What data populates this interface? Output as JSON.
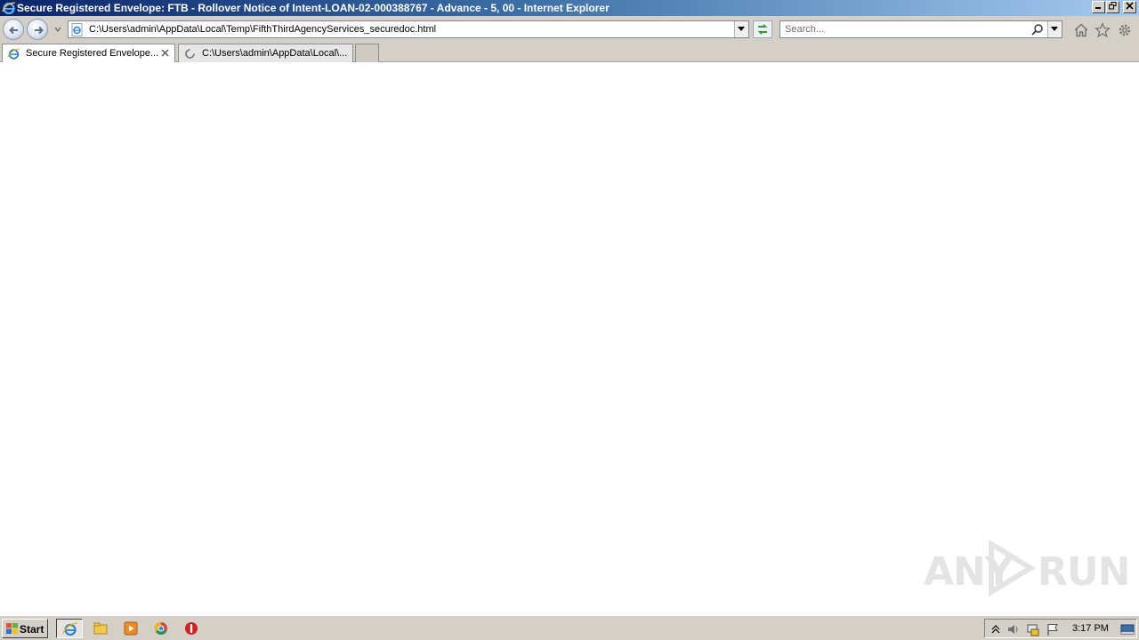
{
  "window": {
    "title": "Secure Registered Envelope: FTB - Rollover Notice of Intent-LOAN-02-000388767 - Advance - 5, 00 - Internet Explorer",
    "buttons": [
      "minimize",
      "restore",
      "close"
    ]
  },
  "navbar": {
    "address_url": "C:\\Users\\admin\\AppData\\Local\\Temp\\FifthThirdAgencyServices_securedoc.html",
    "search_placeholder": "Search...",
    "icons": [
      "back-icon",
      "forward-icon",
      "home-icon",
      "favorites-star-icon",
      "settings-gear-icon"
    ]
  },
  "tabs": [
    {
      "label": "Secure Registered Envelope...",
      "active": true,
      "icon": "ie-page-icon"
    },
    {
      "label": "C:\\Users\\admin\\AppData\\Local\\...",
      "active": false,
      "icon": "loading-spinner-icon"
    }
  ],
  "watermark": {
    "left": "ANY",
    "right": "RUN"
  },
  "taskbar": {
    "start_label": "Start",
    "apps": [
      "internet-explorer-icon",
      "file-explorer-icon",
      "media-player-icon",
      "chrome-icon",
      "antivirus-icon"
    ],
    "clock": "3:17 PM"
  },
  "colors": {
    "titlebar_start": "#0a246a",
    "titlebar_end": "#a6caf0",
    "chrome": "#d4d0c8"
  }
}
